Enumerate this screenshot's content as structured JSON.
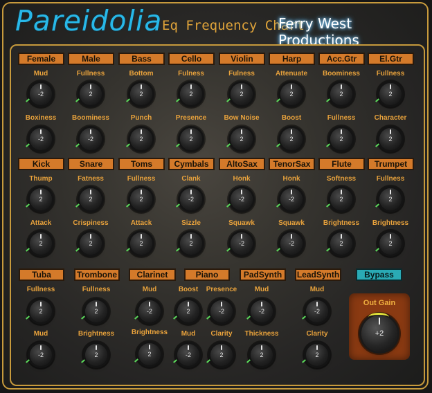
{
  "header": {
    "title": "Pareidolia",
    "subtitle": "Eq Frequency Chart",
    "brand": "Ferry West Productions"
  },
  "row1": {
    "categories": [
      "Female",
      "Male",
      "Bass",
      "Cello",
      "Violin",
      "Harp",
      "Acc.Gtr",
      "El.Gtr"
    ],
    "top_labels": [
      "Mud",
      "Fullness",
      "Bottom",
      "Fulness",
      "Fulness",
      "Attenuate",
      "Boominess",
      "Fullness"
    ],
    "top_values": [
      "-2",
      "2",
      "2",
      "2",
      "2",
      "2",
      "2",
      "2"
    ],
    "bottom_labels": [
      "Boxiness",
      "Boominess",
      "Punch",
      "Presence",
      "Bow Noise",
      "Boost",
      "Fullness",
      "Character"
    ],
    "bottom_values": [
      "-2",
      "-2",
      "2",
      "2",
      "2",
      "2",
      "2",
      "2"
    ]
  },
  "row2": {
    "categories": [
      "Kick",
      "Snare",
      "Toms",
      "Cymbals",
      "AltoSax",
      "TenorSax",
      "Flute",
      "Trumpet"
    ],
    "top_labels": [
      "Thump",
      "Fatness",
      "Fullness",
      "Clank",
      "Honk",
      "Honk",
      "Softness",
      "Fullness"
    ],
    "top_values": [
      "2",
      "2",
      "2",
      "-2",
      "-2",
      "-2",
      "2",
      "2"
    ],
    "bottom_labels": [
      "Attack",
      "Crispiness",
      "Attack",
      "Sizzle",
      "Squawk",
      "Squawk",
      "Brightness",
      "Brightness"
    ],
    "bottom_values": [
      "2",
      "2",
      "2",
      "2",
      "-2",
      "-2",
      "2",
      "2"
    ]
  },
  "row3": {
    "categories": [
      "Tuba",
      "Trombone",
      "Clarinet",
      "Piano",
      "PadSynth",
      "LeadSynth"
    ],
    "bypass_label": "Bypass",
    "top_knobs": [
      {
        "label": "Fullness",
        "value": "2"
      },
      {
        "label": "Fullness",
        "value": "2"
      },
      {
        "label": "Mud",
        "value": "-2"
      },
      {
        "label": "Boost",
        "value": "2"
      },
      {
        "label": "Presence",
        "value": "-2"
      },
      {
        "label": "Mud",
        "value": "-2"
      },
      {
        "label": "Mud",
        "value": "-2"
      }
    ],
    "bottom_knobs": [
      {
        "label": "Mud",
        "value": "-2"
      },
      {
        "label": "Brightness",
        "value": "2"
      },
      {
        "label": "Brightness",
        "value": "2"
      },
      {
        "label": "Mud",
        "value": "-2"
      },
      {
        "label": "Clarity",
        "value": "2"
      },
      {
        "label": "Thickness",
        "value": "2"
      },
      {
        "label": "Clarity",
        "value": "2"
      }
    ]
  },
  "out_gain": {
    "label": "Out Gain",
    "value": "+2"
  },
  "colors": {
    "accent": "#d47a2a",
    "title": "#28b8e8",
    "label": "#e8a23c",
    "bypass": "#2aaab5",
    "frame": "#c79a3c"
  }
}
